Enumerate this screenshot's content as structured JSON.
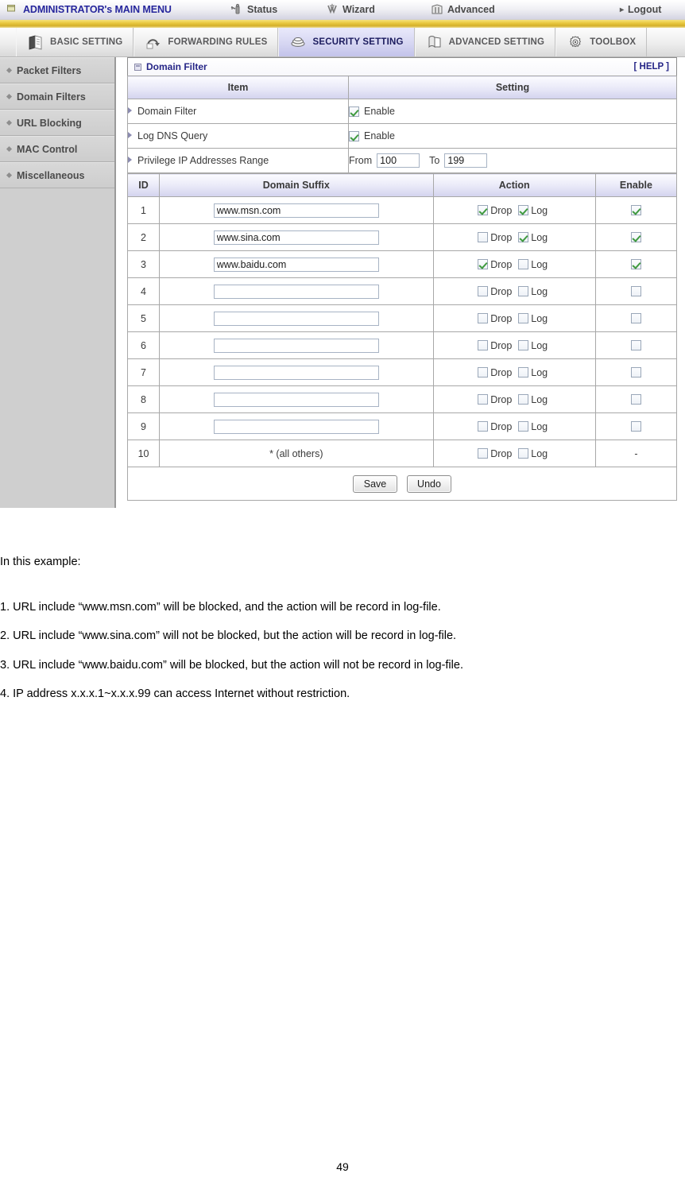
{
  "topbar": {
    "brand": "ADMINISTRATOR's MAIN MENU",
    "items": [
      {
        "label": "Status",
        "icon": "status-icon"
      },
      {
        "label": "Wizard",
        "icon": "wizard-icon"
      },
      {
        "label": "Advanced",
        "icon": "advanced-icon"
      }
    ],
    "logout": "Logout"
  },
  "tabs": [
    {
      "label": "BASIC SETTING",
      "icon": "book-icon",
      "active": false
    },
    {
      "label": "FORWARDING RULES",
      "icon": "arrow-loop-icon",
      "active": false
    },
    {
      "label": "SECURITY SETTING",
      "icon": "shield-stack-icon",
      "active": true
    },
    {
      "label": "ADVANCED SETTING",
      "icon": "cube-icon",
      "active": false
    },
    {
      "label": "TOOLBOX",
      "icon": "gear-tools-icon",
      "active": false
    }
  ],
  "sidebar": {
    "items": [
      {
        "label": "Packet Filters"
      },
      {
        "label": "Domain Filters"
      },
      {
        "label": "URL Blocking"
      },
      {
        "label": "MAC Control"
      },
      {
        "label": "Miscellaneous"
      }
    ]
  },
  "panel": {
    "title": "Domain Filter",
    "help": "[ HELP ]",
    "columns": {
      "item": "Item",
      "setting": "Setting"
    },
    "settings": [
      {
        "item": "Domain Filter",
        "type": "checkbox",
        "label": "Enable",
        "checked": true
      },
      {
        "item": "Log DNS Query",
        "type": "checkbox",
        "label": "Enable",
        "checked": true
      }
    ],
    "ip_range": {
      "item": "Privilege IP Addresses Range",
      "from_label": "From",
      "from_value": "100",
      "to_label": "To",
      "to_value": "199"
    }
  },
  "filter_table": {
    "headers": [
      "ID",
      "Domain Suffix",
      "Action",
      "Enable"
    ],
    "action_labels": {
      "drop": "Drop",
      "log": "Log"
    },
    "rows": [
      {
        "id": "1",
        "suffix": "www.msn.com",
        "drop": true,
        "log": true,
        "enable": true,
        "editable": true
      },
      {
        "id": "2",
        "suffix": "www.sina.com",
        "drop": false,
        "log": true,
        "enable": true,
        "editable": true
      },
      {
        "id": "3",
        "suffix": "www.baidu.com",
        "drop": true,
        "log": false,
        "enable": true,
        "editable": true
      },
      {
        "id": "4",
        "suffix": "",
        "drop": false,
        "log": false,
        "enable": false,
        "editable": true
      },
      {
        "id": "5",
        "suffix": "",
        "drop": false,
        "log": false,
        "enable": false,
        "editable": true
      },
      {
        "id": "6",
        "suffix": "",
        "drop": false,
        "log": false,
        "enable": false,
        "editable": true
      },
      {
        "id": "7",
        "suffix": "",
        "drop": false,
        "log": false,
        "enable": false,
        "editable": true
      },
      {
        "id": "8",
        "suffix": "",
        "drop": false,
        "log": false,
        "enable": false,
        "editable": true
      },
      {
        "id": "9",
        "suffix": "",
        "drop": false,
        "log": false,
        "enable": false,
        "editable": true
      },
      {
        "id": "10",
        "suffix": "* (all others)",
        "drop": false,
        "log": false,
        "enable": "-",
        "editable": false
      }
    ]
  },
  "buttons": {
    "save": "Save",
    "undo": "Undo"
  },
  "doc": {
    "lead": "In this example:",
    "line1": "1. URL include “www.msn.com” will be blocked, and the action will be record in log-file.",
    "line2": "2. URL include “www.sina.com” will not be blocked, but the action will be record in log-file.",
    "line3": "3. URL include “www.baidu.com” will be blocked, but the action will not be record in log-file.",
    "line4": "4. IP address x.x.x.1~x.x.x.99 can access Internet without restriction."
  },
  "page_number": "49",
  "colors": {
    "brand_text": "#26269c",
    "gold_bar": "#e8c840",
    "active_tab": "#c3c3ea",
    "header_gradient": "#d3d3ee",
    "sidebar_bg": "#cfcfcf",
    "check_green": "#3f9a3f"
  }
}
